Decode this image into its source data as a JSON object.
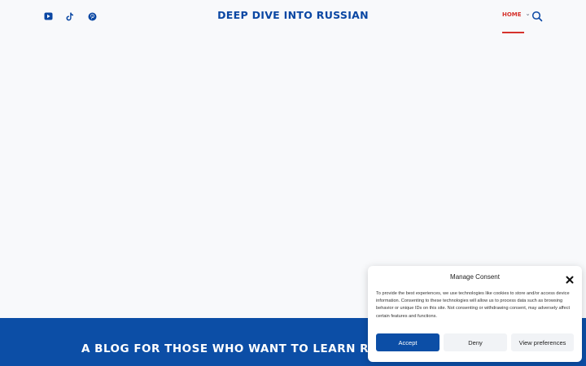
{
  "header": {
    "social": [
      {
        "icon": "youtube-icon",
        "color": "#0a47a3"
      },
      {
        "icon": "tiktok-icon",
        "color": "#0a47a3"
      },
      {
        "icon": "pinterest-icon",
        "color": "#0a47a3"
      }
    ],
    "site_title": "DEEP DIVE INTO RUSSIAN",
    "nav": {
      "home_label": "HOME",
      "dropdown_glyph": "⌄",
      "active_color": "#d6322c"
    },
    "search_icon": "search-icon"
  },
  "hero": {
    "background": "#0c4ea6",
    "title": "A BLOG FOR THOSE WHO WANT TO LEARN RUSSIAN A"
  },
  "consent": {
    "title": "Manage Consent",
    "close_icon": "close-icon",
    "text": "To provide the best experiences, we use technologies like cookies to store and/or access device information. Consenting to these technologies will allow us to process data such as browsing behavior or unique IDs on this site. Not consenting or withdrawing consent, may adversely affect certain features and functions.",
    "buttons": {
      "accept": "Accept",
      "deny": "Deny",
      "preferences": "View preferences"
    },
    "accent": "#0c4ea6"
  }
}
